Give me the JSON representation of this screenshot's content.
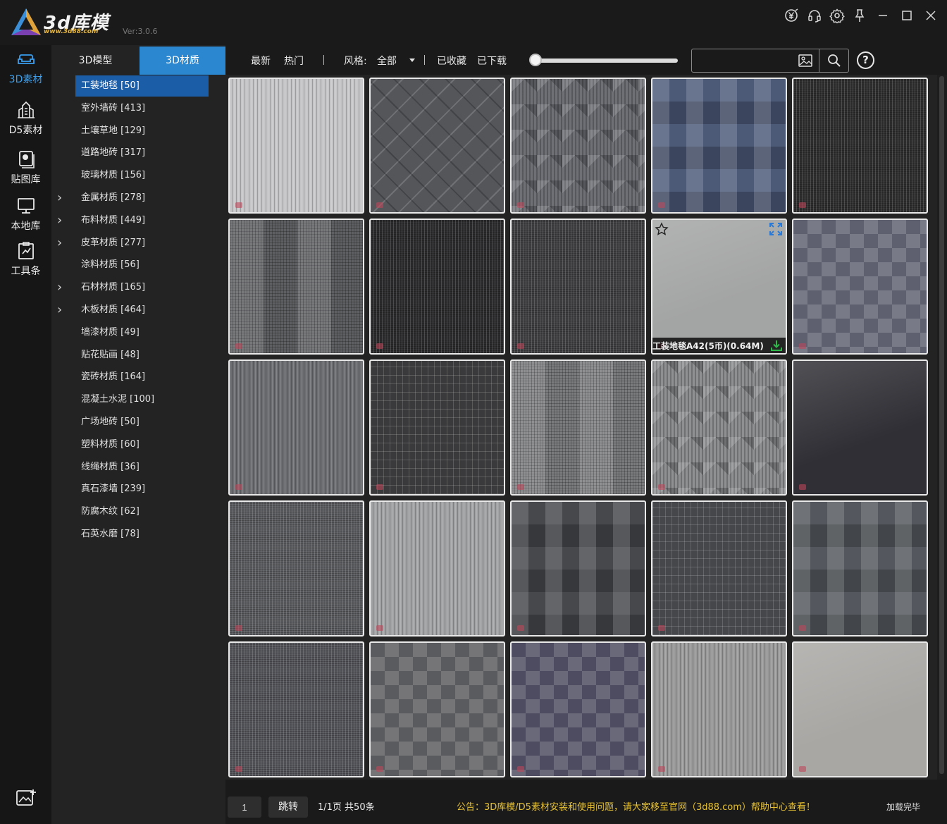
{
  "app": {
    "name": "3d库模",
    "url": "www.3d88.com",
    "version": "Ver:3.0.6"
  },
  "window_controls": [
    "yuan-coin-icon",
    "headset-icon",
    "gear-icon",
    "pin-icon",
    "minimize-icon",
    "maximize-icon",
    "close-icon"
  ],
  "rail": [
    {
      "label": "3D素材",
      "icon": "sofa-icon",
      "active": true
    },
    {
      "label": "D5素材",
      "icon": "building-icon",
      "active": false
    },
    {
      "label": "贴图库",
      "icon": "image-stack-icon",
      "active": false
    },
    {
      "label": "本地库",
      "icon": "monitor-icon",
      "active": false
    },
    {
      "label": "工具条",
      "icon": "toolbox-icon",
      "active": false
    }
  ],
  "tabs": [
    {
      "label": "3D模型",
      "active": false
    },
    {
      "label": "3D材质",
      "active": true
    }
  ],
  "categories": [
    {
      "label": "工装地毯 [50]",
      "expandable": false,
      "active": true
    },
    {
      "label": "室外墙砖 [413]",
      "expandable": false,
      "active": false
    },
    {
      "label": "土壤草地 [129]",
      "expandable": false,
      "active": false
    },
    {
      "label": "道路地砖 [317]",
      "expandable": false,
      "active": false
    },
    {
      "label": "玻璃材质 [156]",
      "expandable": false,
      "active": false
    },
    {
      "label": "金属材质 [278]",
      "expandable": true,
      "active": false
    },
    {
      "label": "布料材质 [449]",
      "expandable": true,
      "active": false
    },
    {
      "label": "皮革材质 [277]",
      "expandable": true,
      "active": false
    },
    {
      "label": "涂料材质 [56]",
      "expandable": false,
      "active": false
    },
    {
      "label": "石材材质 [165]",
      "expandable": true,
      "active": false
    },
    {
      "label": "木板材质 [464]",
      "expandable": true,
      "active": false
    },
    {
      "label": "墙漆材质 [49]",
      "expandable": false,
      "active": false
    },
    {
      "label": "贴花贴画 [48]",
      "expandable": false,
      "active": false
    },
    {
      "label": "瓷砖材质 [164]",
      "expandable": false,
      "active": false
    },
    {
      "label": "混凝土水泥 [100]",
      "expandable": false,
      "active": false
    },
    {
      "label": "广场地砖 [50]",
      "expandable": false,
      "active": false
    },
    {
      "label": "塑料材质 [60]",
      "expandable": false,
      "active": false
    },
    {
      "label": "线绳材质 [36]",
      "expandable": false,
      "active": false
    },
    {
      "label": "真石漆墙 [239]",
      "expandable": false,
      "active": false
    },
    {
      "label": "防腐木纹 [62]",
      "expandable": false,
      "active": false
    },
    {
      "label": "石英水磨 [78]",
      "expandable": false,
      "active": false
    }
  ],
  "toolbar": {
    "latest": "最新",
    "hot": "热门",
    "style_label": "风格:",
    "style_value": "全部",
    "favorites": "已收藏",
    "downloaded": "已下载",
    "size_slider": 0.0,
    "search_placeholder": "",
    "help": "?"
  },
  "hovered_tile": {
    "index": 8,
    "name": "工装地毯A42(5币)(0.64M)"
  },
  "tiles": [
    {
      "base": "#c6c6c8",
      "pattern": "streak"
    },
    {
      "base": "#55565a",
      "pattern": "diamond"
    },
    {
      "base": "#6e7076",
      "pattern": "zigzag"
    },
    {
      "base": "#4c5a78",
      "pattern": "blocks"
    },
    {
      "base": "#2e2e2e",
      "pattern": "noise"
    },
    {
      "base": "#5d5f62",
      "pattern": "basket"
    },
    {
      "base": "#2b2b2d",
      "pattern": "noise"
    },
    {
      "base": "#3f3f41",
      "pattern": "noise"
    },
    {
      "base": "#a3a4a4",
      "pattern": "plain"
    },
    {
      "base": "#5e6070",
      "pattern": "checker"
    },
    {
      "base": "#6d6e72",
      "pattern": "streak"
    },
    {
      "base": "#3a3a3c",
      "pattern": "grid"
    },
    {
      "base": "#7a7b7d",
      "pattern": "basket"
    },
    {
      "base": "#8e9092",
      "pattern": "zigzag"
    },
    {
      "base": "#2f2f35",
      "pattern": "plain"
    },
    {
      "base": "#5a5b5e",
      "pattern": "noise"
    },
    {
      "base": "#a2a3a5",
      "pattern": "streak"
    },
    {
      "base": "#46484c",
      "pattern": "blocks"
    },
    {
      "base": "#45474b",
      "pattern": "grid"
    },
    {
      "base": "#54585e",
      "pattern": "blocks"
    },
    {
      "base": "#54555a",
      "pattern": "noise"
    },
    {
      "base": "#5a5b5e",
      "pattern": "checker"
    },
    {
      "base": "#4e4c60",
      "pattern": "checker"
    },
    {
      "base": "#9a9a9a",
      "pattern": "streak"
    },
    {
      "base": "#a9a7a4",
      "pattern": "plain"
    }
  ],
  "pagination": {
    "page_input": "1",
    "jump_label": "跳转",
    "info": "1/1页 共50条"
  },
  "notice": "公告：3D库模/D5素材安装和使用问题，请大家移至官网（3d88.com）帮助中心查看！",
  "load_status": "加载完毕",
  "colors": {
    "accent": "#2a87d0",
    "active_category": "#1c5da8",
    "notice": "#e8c232",
    "download": "#2fb84a"
  }
}
